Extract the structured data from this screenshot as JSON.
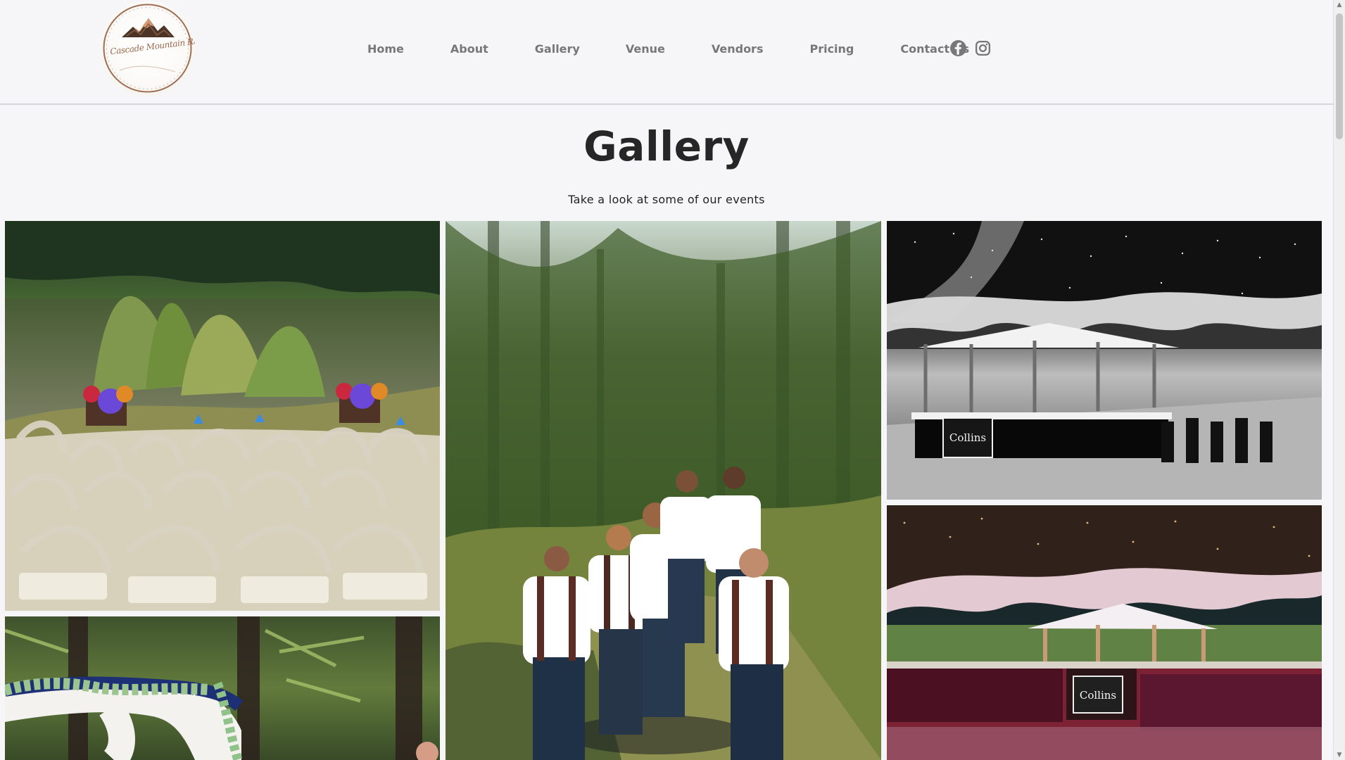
{
  "logo": {
    "text": "Cascade Mountain Ranch"
  },
  "nav": {
    "items": [
      {
        "label": "Home"
      },
      {
        "label": "About"
      },
      {
        "label": "Gallery"
      },
      {
        "label": "Venue"
      },
      {
        "label": "Vendors"
      },
      {
        "label": "Pricing"
      },
      {
        "label": "Contact Us"
      }
    ]
  },
  "social": {
    "facebook": "facebook-icon",
    "instagram": "instagram-icon"
  },
  "gallery": {
    "title": "Gallery",
    "subtitle": "Take a look at some of our events",
    "images": [
      {
        "name": "lake-ceremony-chairs"
      },
      {
        "name": "groomsmen-walking"
      },
      {
        "name": "black-white-pavilion"
      },
      {
        "name": "decorated-arch"
      },
      {
        "name": "color-pavilion"
      }
    ]
  },
  "signs": {
    "bw_sign": "Collins",
    "color_sign": "Collins"
  },
  "colors": {
    "background": "#f6f6f8",
    "nav_text": "#777777",
    "title_text": "#262626",
    "logo_brown": "#9d6a4f"
  }
}
